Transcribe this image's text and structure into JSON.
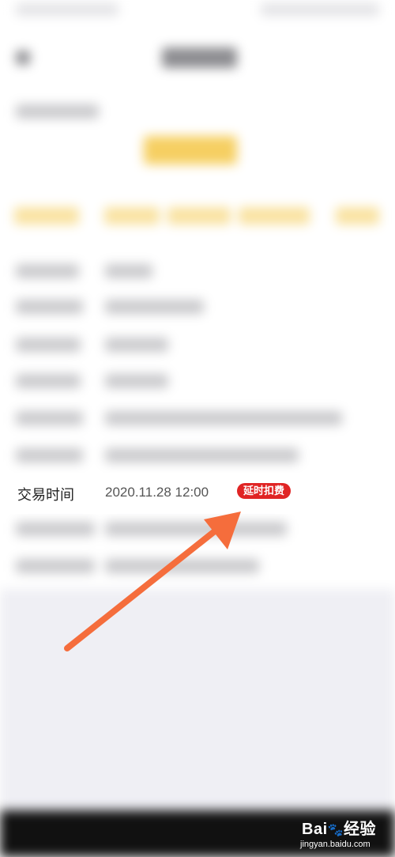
{
  "transaction": {
    "label": "交易时间",
    "value": "2020.11.28 12:00",
    "badge": "延时扣费"
  },
  "watermark": {
    "brand": "Bai",
    "brand_suffix": "经验",
    "url": "jingyan.baidu.com"
  },
  "colors": {
    "badge_red": "#e02424",
    "arrow_orange": "#f56d3c",
    "accent_yellow": "#f6cf62"
  }
}
